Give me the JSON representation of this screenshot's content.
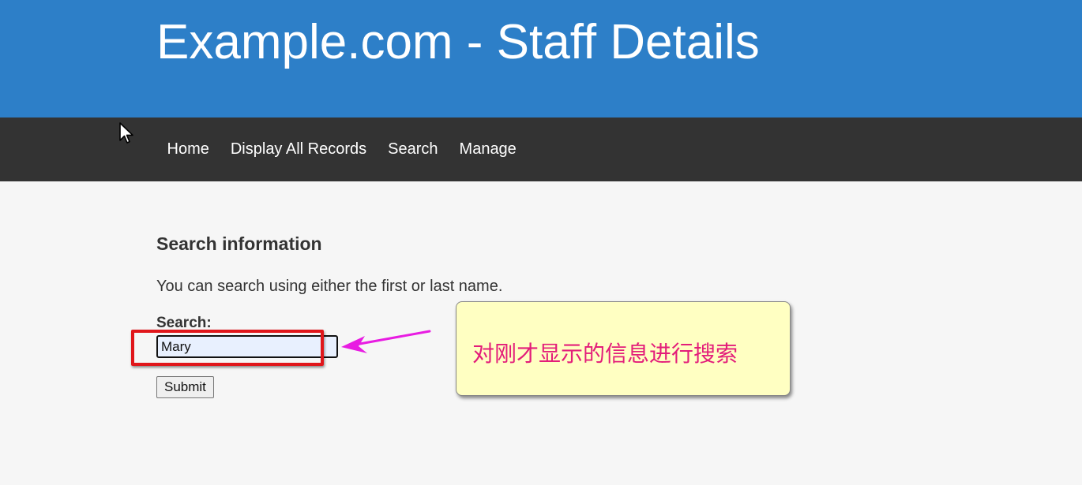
{
  "header": {
    "title": "Example.com - Staff Details"
  },
  "nav": {
    "items": [
      {
        "label": "Home"
      },
      {
        "label": "Display All Records"
      },
      {
        "label": "Search"
      },
      {
        "label": "Manage"
      }
    ]
  },
  "main": {
    "heading": "Search information",
    "intro": "You can search using either the first or last name.",
    "search_label": "Search:",
    "search_value": "Mary",
    "submit_label": "Submit"
  },
  "annotation": {
    "callout_text": "对刚才显示的信息进行搜索"
  },
  "colors": {
    "header_bg": "#2d7fc8",
    "nav_bg": "#333333",
    "highlight_border": "#e0161b",
    "arrow": "#e81ce2",
    "callout_bg": "#ffffc2",
    "callout_text": "#e31d7a"
  },
  "icons": {
    "cursor": "mouse-pointer-icon",
    "arrow": "arrow-left-icon"
  }
}
